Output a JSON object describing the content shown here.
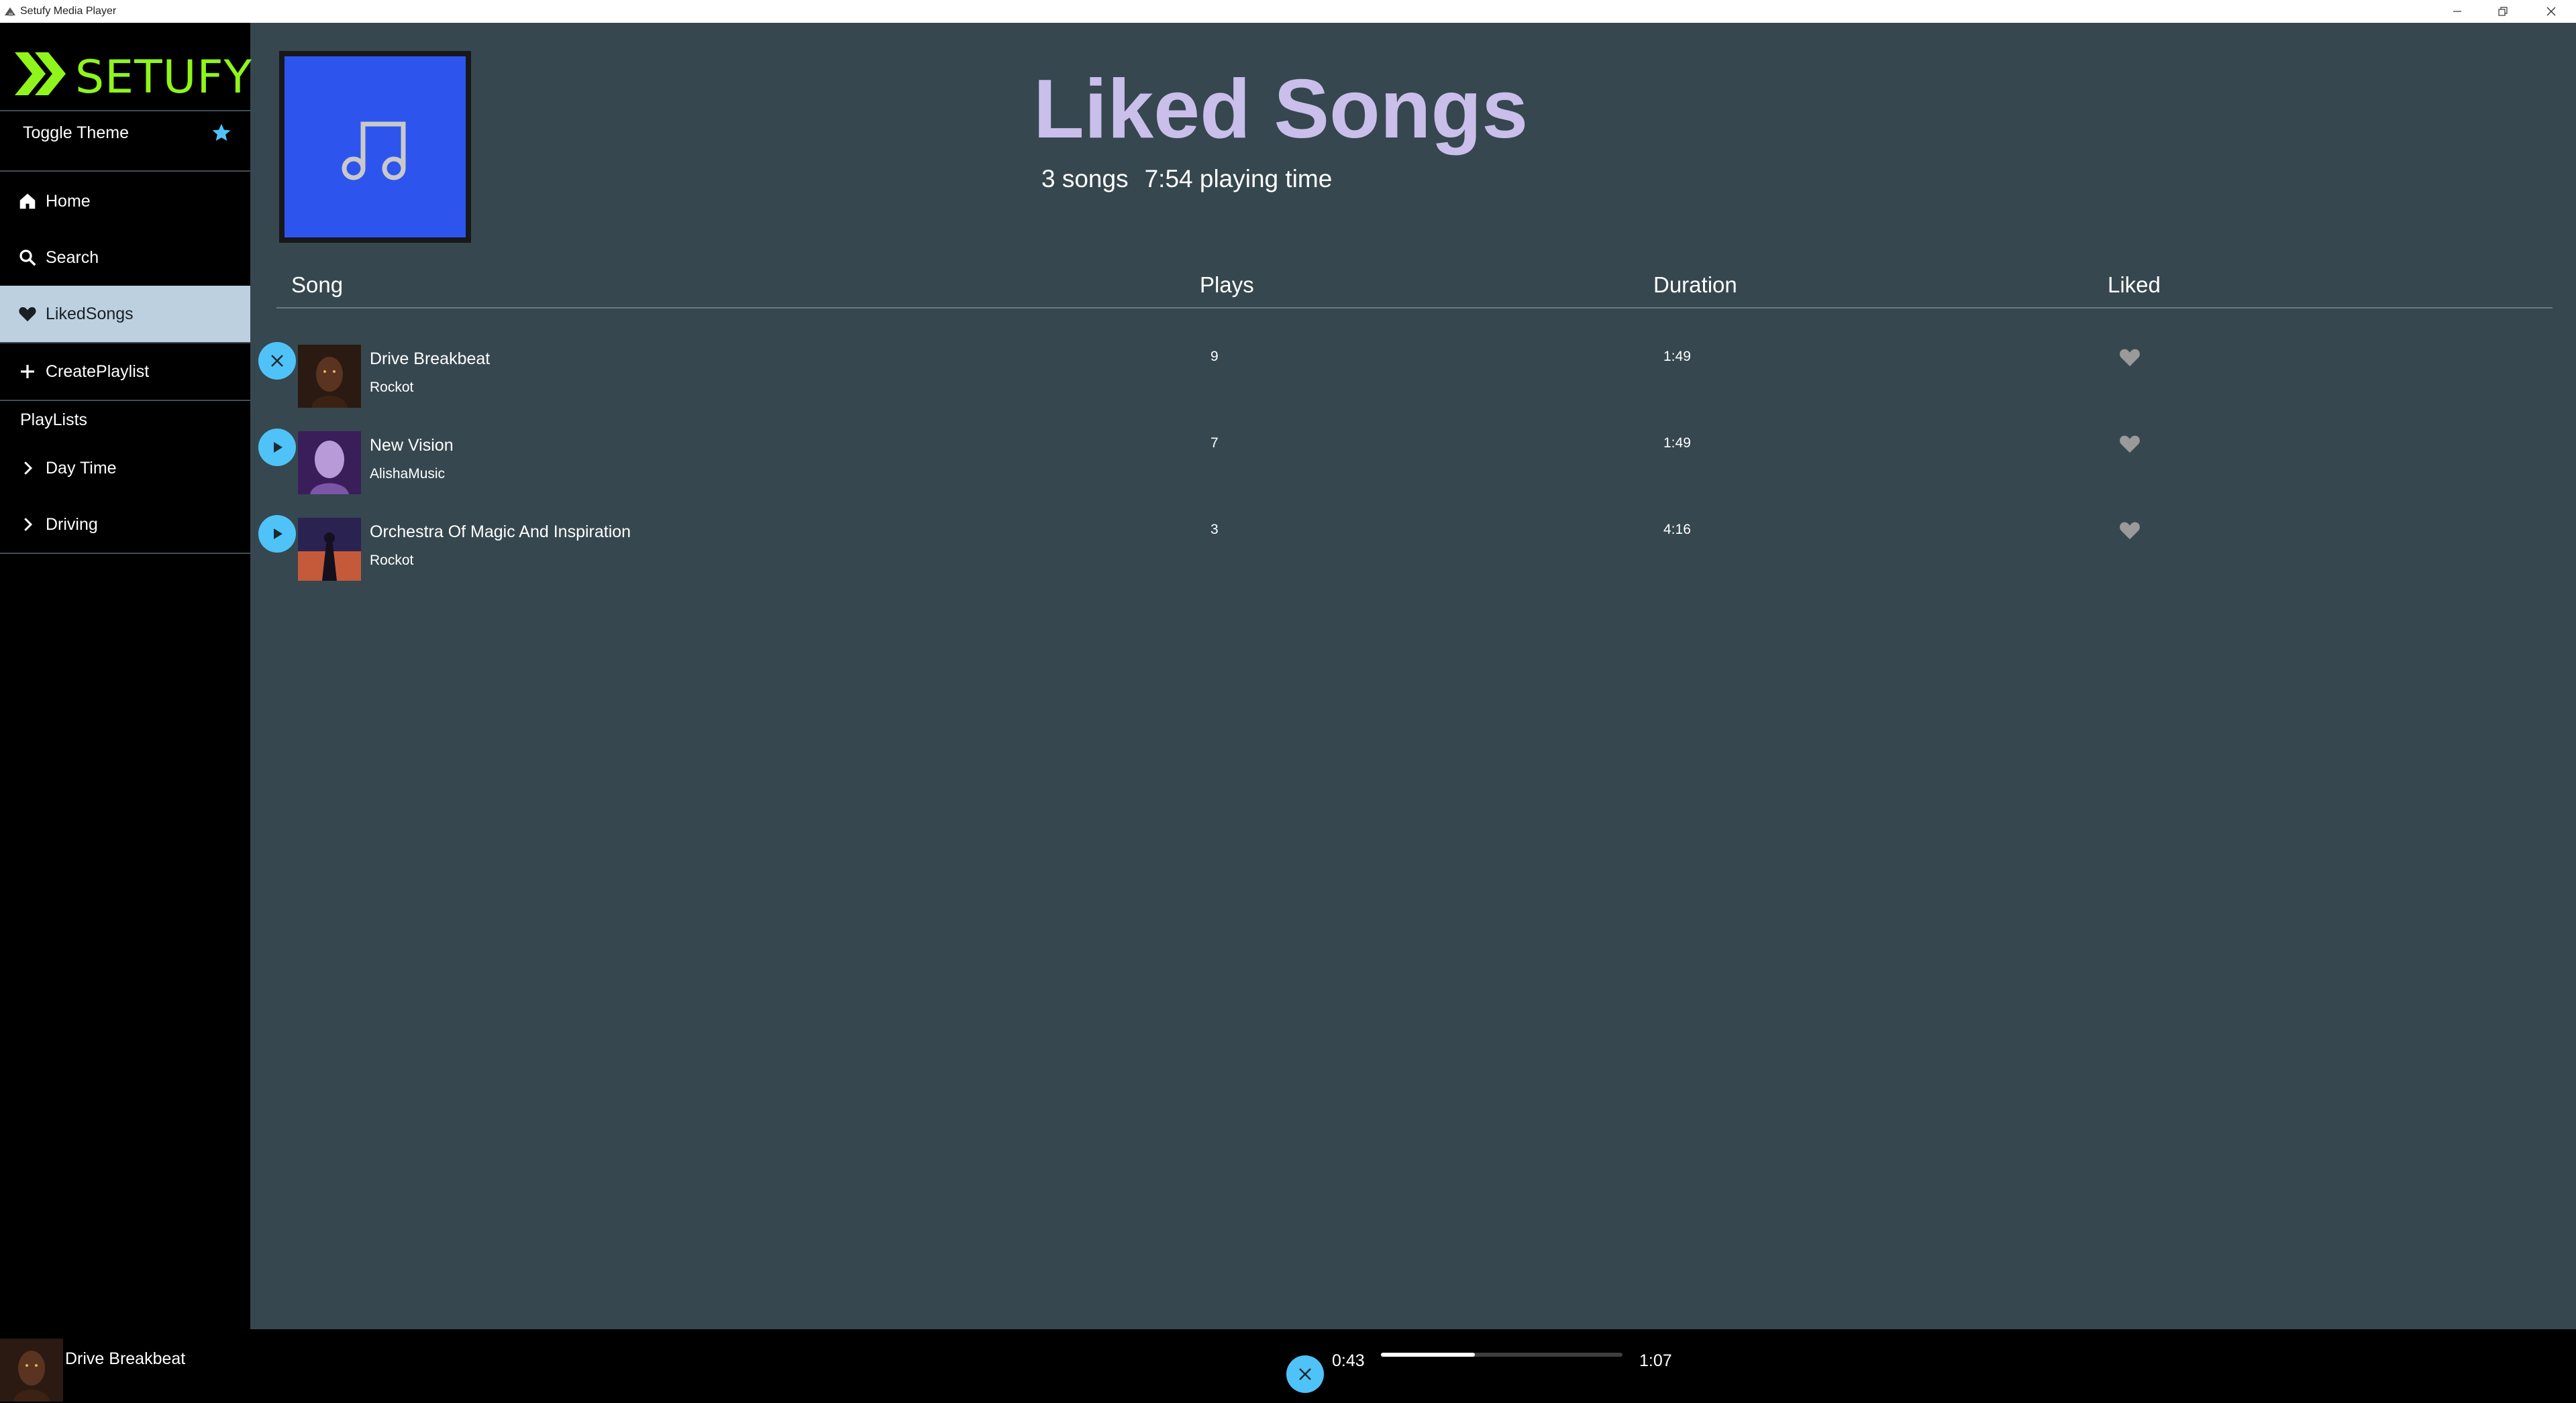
{
  "window": {
    "title": "Setufy Media Player"
  },
  "sidebar": {
    "logo_text": "SETUFY",
    "toggle_theme_label": "Toggle Theme",
    "nav": [
      {
        "label": "Home",
        "icon": "home-icon"
      },
      {
        "label": "Search",
        "icon": "search-icon"
      },
      {
        "label": "LikedSongs",
        "icon": "heart-icon",
        "active": true
      },
      {
        "label": "CreatePlaylist",
        "icon": "plus-icon"
      }
    ],
    "playlists_label": "PlayLists",
    "playlists": [
      {
        "label": "Day Time",
        "icon": "chevron-right-icon"
      },
      {
        "label": "Driving",
        "icon": "chevron-right-icon"
      }
    ]
  },
  "header": {
    "title": "Liked Songs",
    "song_count": "3 songs",
    "playing_time": "7:54 playing time",
    "cover_icon": "music-note-icon"
  },
  "table": {
    "columns": {
      "song": "Song",
      "plays": "Plays",
      "duration": "Duration",
      "liked": "Liked"
    },
    "rows": [
      {
        "title": "Drive Breakbeat",
        "artist": "Rockot",
        "plays": "9",
        "duration": "1:49",
        "state_icon": "close-icon"
      },
      {
        "title": "New Vision",
        "artist": "AlishaMusic",
        "plays": "7",
        "duration": "1:49",
        "state_icon": "play-icon"
      },
      {
        "title": "Orchestra Of Magic And Inspiration",
        "artist": "Rockot",
        "plays": "3",
        "duration": "4:16",
        "state_icon": "play-icon"
      }
    ]
  },
  "player": {
    "title": "Drive Breakbeat",
    "elapsed": "0:43",
    "total": "1:07",
    "progress_fraction": 0.39
  },
  "colors": {
    "accent": "#4fc3f7",
    "brand": "#8ff51b",
    "title": "#c9bfea",
    "cover": "#2d55ee",
    "main_bg": "#36474f"
  }
}
